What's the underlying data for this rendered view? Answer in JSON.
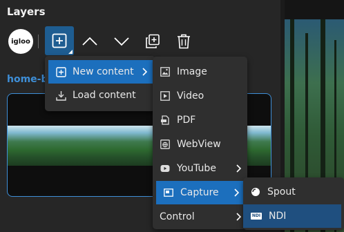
{
  "panel": {
    "title": "Layers"
  },
  "toolbar": {
    "logo_text": "igloo"
  },
  "layer": {
    "name": "home-b"
  },
  "menu_main": {
    "items": [
      {
        "label": "New content",
        "icon": "add-content-icon",
        "has_submenu": true,
        "selected": true
      },
      {
        "label": "Load content",
        "icon": "download-icon",
        "has_submenu": false,
        "selected": false
      }
    ]
  },
  "menu_content": {
    "items": [
      {
        "label": "Image",
        "icon": "image-icon"
      },
      {
        "label": "Video",
        "icon": "video-icon"
      },
      {
        "label": "PDF",
        "icon": "pdf-icon"
      },
      {
        "label": "WebView",
        "icon": "webview-icon"
      },
      {
        "label": "YouTube",
        "icon": "youtube-icon"
      },
      {
        "label": "Capture",
        "icon": "capture-icon"
      },
      {
        "label": "Control",
        "icon": "control-icon"
      }
    ]
  },
  "menu_capture": {
    "items": [
      {
        "label": "Spout",
        "icon": "spout-icon"
      },
      {
        "label": "NDI",
        "icon": "ndi-icon",
        "badge": "NDI"
      }
    ]
  },
  "colors": {
    "accent": "#1c6fbd",
    "accent_dark": "#1e5d91",
    "link": "#3e8fd8",
    "menu_bg": "#2f2f2f",
    "panel_bg": "#262626"
  }
}
